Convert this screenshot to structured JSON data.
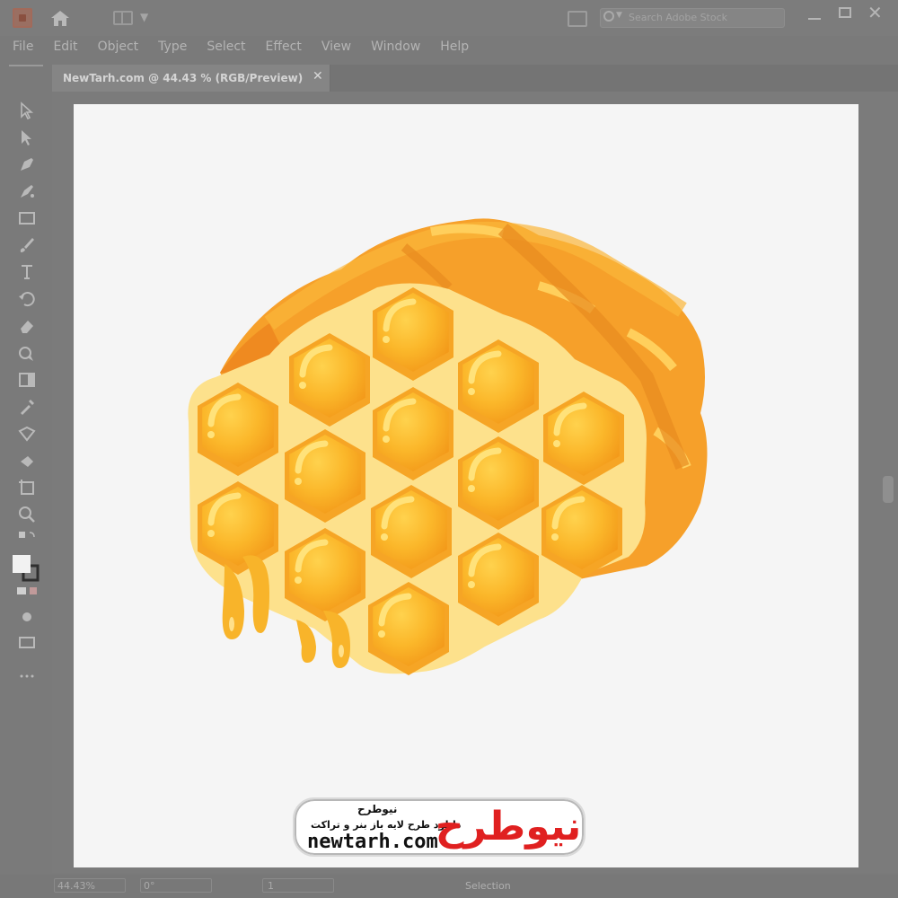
{
  "menu": [
    "File",
    "Edit",
    "Object",
    "Type",
    "Select",
    "Effect",
    "View",
    "Window",
    "Help"
  ],
  "search": {
    "placeholder": "Search Adobe Stock"
  },
  "tab": {
    "title": "NewTarh.com @ 44.43 % (RGB/Preview)",
    "close": "✕"
  },
  "status": {
    "zoom": "44.43%",
    "rotation": "0°",
    "page": "1",
    "mode": "Selection"
  },
  "watermark": {
    "url": "newtarh.com",
    "fa_brand": "نیوطرح",
    "fa_tagline": "دانلود طرح لایه باز بنر و تراکت",
    "logo_text": "نیوطرح"
  },
  "icons": {
    "home": "home-icon",
    "workspace": "workspace-icon",
    "search": "search-icon",
    "tools": [
      "selection-tool-icon",
      "direct-selection-tool-icon",
      "pen-tool-icon",
      "curvature-tool-icon",
      "rectangle-tool-icon",
      "paintbrush-tool-icon",
      "type-tool-icon",
      "rotate-tool-icon",
      "eraser-tool-icon",
      "shape-builder-icon",
      "gradient-tool-icon",
      "eyedropper-tool-icon",
      "blend-tool-icon",
      "symbol-sprayer-icon",
      "artboard-tool-icon",
      "zoom-tool-icon",
      "swap-colors-icon",
      "fill-stroke-icon",
      "color-mode-icon",
      "draw-mode-icon",
      "screen-mode-icon",
      "more-tools-icon"
    ]
  },
  "colors": {
    "honey_light": "#fbc02d",
    "honey_dark": "#f29a1f",
    "comb": "#fde49a",
    "wax": "#f9a825"
  }
}
